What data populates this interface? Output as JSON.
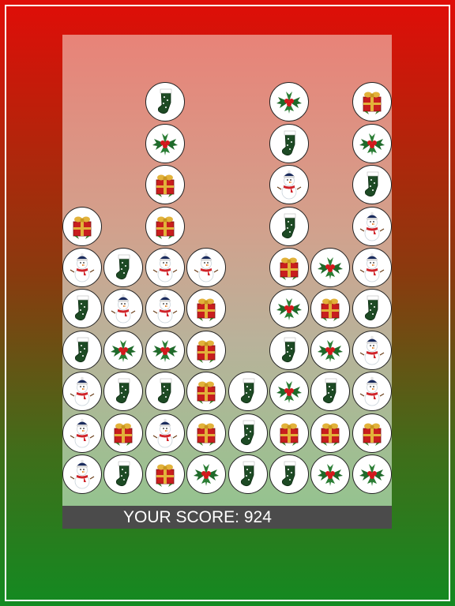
{
  "game": {
    "score_text": "YOUR SCORE: 924",
    "piece_types": [
      "stocking",
      "holly",
      "gift",
      "snowman"
    ],
    "columns": [
      [
        "snowman",
        "snowman",
        "snowman",
        "stocking",
        "stocking",
        "snowman",
        "gift"
      ],
      [
        "stocking",
        "gift",
        "stocking",
        "holly",
        "snowman",
        "stocking"
      ],
      [
        "gift",
        "snowman",
        "stocking",
        "holly",
        "snowman",
        "snowman",
        "gift",
        "gift",
        "holly",
        "stocking"
      ],
      [
        "holly",
        "gift",
        "gift",
        "gift",
        "gift",
        "snowman"
      ],
      [
        "stocking",
        "stocking",
        "stocking"
      ],
      [
        "stocking",
        "gift",
        "holly",
        "stocking",
        "holly",
        "gift",
        "stocking",
        "snowman",
        "stocking",
        "holly"
      ],
      [
        "holly",
        "gift",
        "stocking",
        "holly",
        "gift",
        "holly"
      ],
      [
        "holly",
        "gift",
        "snowman",
        "snowman",
        "stocking",
        "snowman",
        "snowman",
        "stocking",
        "holly",
        "gift"
      ]
    ],
    "colors": {
      "stocking": "#1d4a24",
      "holly_leaf": "#1f6a2a",
      "berry": "#d3181c",
      "gift_box": "#c81e1e",
      "gift_ribbon": "#e2b23a",
      "snowman_hat": "#1a2b5c",
      "scarf": "#d0242a"
    }
  }
}
